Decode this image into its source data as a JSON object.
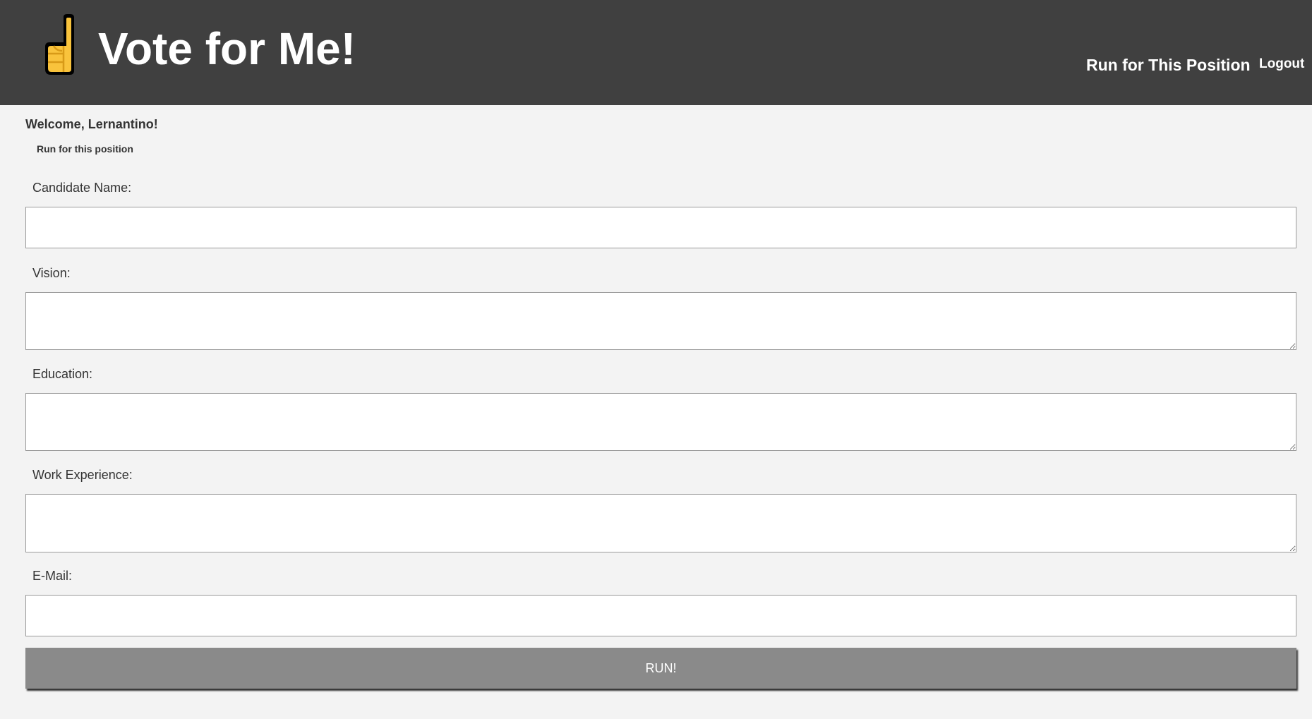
{
  "header": {
    "logo_icon": "pointing-up-hand-icon",
    "title": "Vote for Me!",
    "background": "#404040",
    "nav": {
      "run_label": "Run for This Position",
      "logout_label": "Logout"
    }
  },
  "main": {
    "welcome": "Welcome, Lernantino!",
    "subtitle": "Run for this position",
    "form": {
      "candidate_name": {
        "label": "Candidate Name:",
        "value": ""
      },
      "vision": {
        "label": "Vision:",
        "value": ""
      },
      "education": {
        "label": "Education:",
        "value": ""
      },
      "work_experience": {
        "label": "Work Experience:",
        "value": ""
      },
      "email": {
        "label": "E-Mail:",
        "value": ""
      },
      "submit_label": "RUN!"
    }
  },
  "colors": {
    "page_background": "#f3f3f3",
    "button": "#8a8a8a",
    "text": "#333333"
  }
}
